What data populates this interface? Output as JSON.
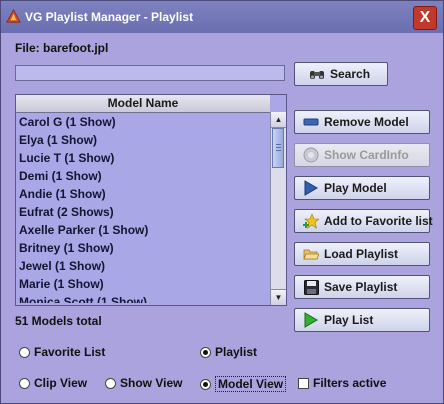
{
  "window": {
    "title": "VG Playlist Manager - Playlist",
    "close_label": "X"
  },
  "file": {
    "label": "File: barefoot.jpl"
  },
  "search": {
    "value": "",
    "button_label": "Search"
  },
  "list": {
    "header": "Model Name",
    "items": [
      "Carol G (1 Show)",
      "Elya (1 Show)",
      "Lucie T (1 Show)",
      "Demi (1 Show)",
      "Andie (1 Show)",
      "Eufrat (2 Shows)",
      "Axelle Parker (1 Show)",
      "Britney (1 Show)",
      "Jewel (1 Show)",
      "Marie (1 Show)",
      "Monica Scott (1 Show)"
    ],
    "total": "51 Models total"
  },
  "buttons": {
    "remove_model": "Remove Model",
    "show_cardinfo": "Show CardInfo",
    "play_model": "Play Model",
    "add_favorite": "Add to Favorite list",
    "load_playlist": "Load Playlist",
    "save_playlist": "Save Playlist",
    "play_list": "Play List"
  },
  "options": {
    "favorite_list": "Favorite List",
    "playlist": "Playlist",
    "clip_view": "Clip View",
    "show_view": "Show View",
    "model_view": "Model View",
    "filters_active": "Filters active",
    "selected_list": "Playlist",
    "selected_view": "Model View",
    "filters_checked": false
  },
  "icons": {
    "app": "app-icon",
    "search": "binoculars-icon",
    "remove": "minus-bar-icon",
    "show_cardinfo": "info-disc-icon",
    "play_model": "play-icon",
    "add_favorite": "star-plus-icon",
    "load": "folder-open-icon",
    "save": "floppy-disk-icon",
    "play_list": "play-green-icon"
  }
}
